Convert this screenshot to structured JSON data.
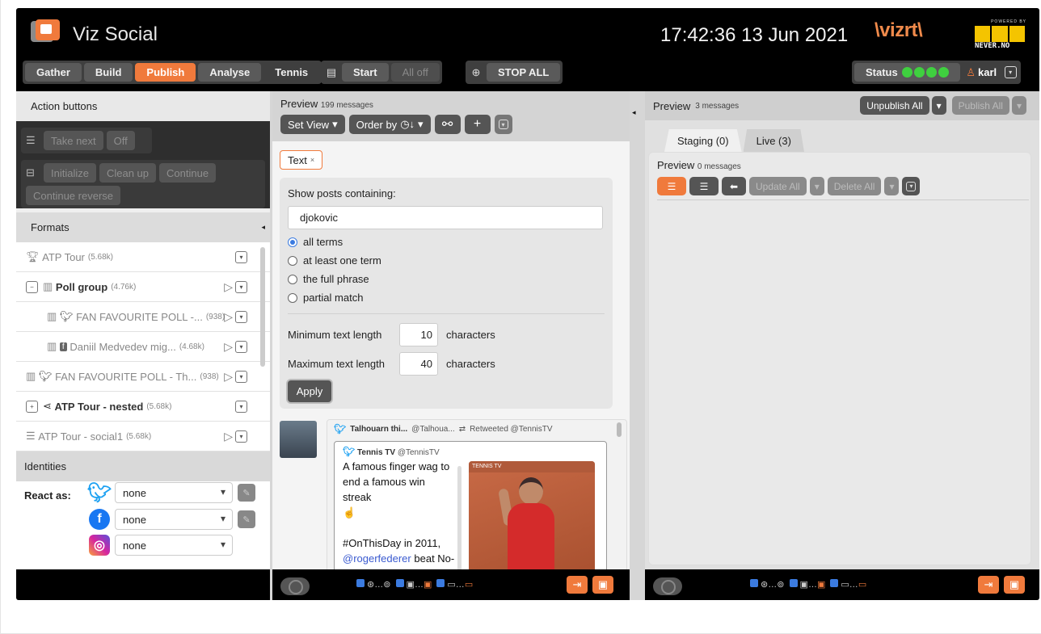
{
  "header": {
    "app_name": "Viz Social",
    "clock": "17:42:36 13 Jun 2021",
    "brand": "vizrt",
    "partner_small": "POWERED BY",
    "partner_name": "NEVER.NO",
    "nav": [
      "Gather",
      "Build",
      "Publish",
      "Analyse",
      "Tennis"
    ],
    "active_nav": "Publish",
    "start_label": "Start",
    "alloff_label": "All off",
    "stopall_label": "STOP ALL",
    "status_label": "Status",
    "user_name": "karl",
    "status_color": "#3fd03f",
    "accent_color": "#f07a3c"
  },
  "left": {
    "action_title": "Action buttons",
    "take_next": "Take next",
    "off": "Off",
    "initialize": "Initialize",
    "clean_up": "Clean up",
    "continue": "Continue",
    "continue_reverse": "Continue reverse",
    "formats_title": "Formats",
    "formats": [
      {
        "icon": "trophy-icon",
        "label": "ATP Tour",
        "count": "(5.68k)"
      },
      {
        "icon": "poll-icon",
        "label": "Poll group",
        "count": "(4.76k)"
      },
      {
        "icon": "twitter-icon",
        "label": "FAN FAVOURITE POLL -...",
        "count": "(938)"
      },
      {
        "icon": "facebook-icon",
        "label": "Daniil Medvedev mig...",
        "count": "(4.68k)"
      },
      {
        "icon": "twitter-icon",
        "label": "FAN FAVOURITE POLL - Th...",
        "count": "(938)"
      },
      {
        "icon": "share-icon",
        "label": "ATP Tour - nested",
        "count": "(5.68k)"
      },
      {
        "icon": "list-icon",
        "label": "ATP Tour - social1",
        "count": "(5.68k)"
      }
    ],
    "identities_title": "Identities",
    "react_as": "React as:",
    "identities": [
      "none",
      "none",
      "none"
    ]
  },
  "middle": {
    "preview_label": "Preview",
    "message_count": "199 messages",
    "set_view": "Set View",
    "order_by": "Order by",
    "chip": "Text",
    "show_posts": "Show posts containing:",
    "query": "djokovic",
    "radios": [
      "all terms",
      "at least one term",
      "the full phrase",
      "partial match"
    ],
    "min_label": "Minimum text length",
    "min_value": "10",
    "max_label": "Maximum text length",
    "max_value": "40",
    "characters": "characters",
    "apply": "Apply",
    "post": {
      "rt_name": "Talhouarn thi...",
      "rt_handle": "@Talhoua...",
      "rt_text": "Retweeted @TennisTV",
      "author": "Tennis TV",
      "author_handle": "@TennisTV",
      "text_1": "A famous finger wag to end a famous win streak",
      "text_2": "#OnThisDay in 2011,",
      "mention": "@rogerfederer",
      "text_3": "beat No-vak Djokovic in the",
      "photo_tag": "TENNIS TV"
    }
  },
  "right": {
    "preview_label": "Preview",
    "message_count": "3 messages",
    "unpublish_all": "Unpublish All",
    "publish_all": "Publish All",
    "tabs": [
      "Staging (0)",
      "Live (3)"
    ],
    "inner_preview": "Preview",
    "inner_count": "0 messages",
    "update_all": "Update All",
    "delete_all": "Delete All"
  }
}
